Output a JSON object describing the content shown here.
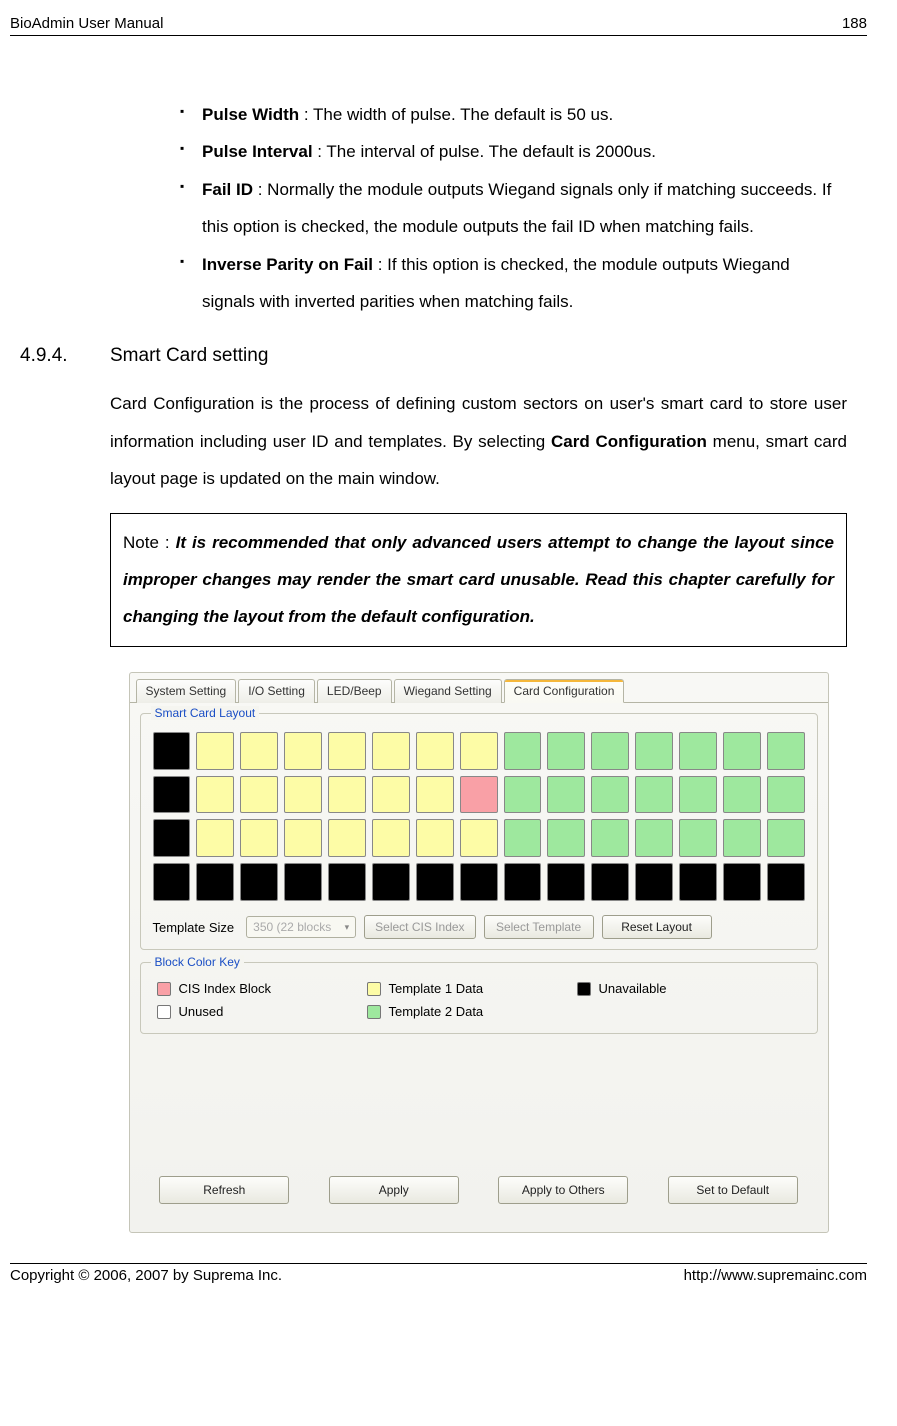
{
  "header": {
    "title": "BioAdmin User Manual",
    "page_num": "188"
  },
  "bullets": [
    {
      "label": "Pulse Width",
      "text": " : The width of pulse. The default is 50 us."
    },
    {
      "label": "Pulse Interval",
      "text": " : The interval of pulse. The default is 2000us."
    },
    {
      "label": "Fail ID",
      "text": " : Normally the module outputs Wiegand signals only if matching succeeds. If this option is checked, the module outputs the fail ID when matching fails."
    },
    {
      "label": "Inverse Parity on Fail",
      "text": " : If this option is checked, the module outputs Wiegand signals with inverted parities when matching fails."
    }
  ],
  "section": {
    "num": "4.9.4.",
    "title": "Smart Card setting"
  },
  "para": {
    "pre": "Card Configuration is the process of defining custom sectors on user's smart card to store user information including user ID and templates. By selecting ",
    "bold": "Card Configuration",
    "post": " menu, smart card layout page is updated on the main window."
  },
  "note": {
    "prefix": "Note : ",
    "body": "It is recommended that only advanced users attempt to change the layout since improper changes may render the smart card unusable. Read this chapter carefully for changing the layout from the default configuration."
  },
  "app": {
    "tabs": [
      "System Setting",
      "I/O Setting",
      "LED/Beep",
      "Wiegand Setting",
      "Card Configuration"
    ],
    "active_tab": 4,
    "fieldset1_legend": "Smart Card Layout",
    "grid": [
      [
        "black",
        "yellow",
        "yellow",
        "yellow",
        "yellow",
        "yellow",
        "yellow",
        "yellow",
        "green",
        "green",
        "green",
        "green",
        "green",
        "green",
        "green"
      ],
      [
        "black",
        "yellow",
        "yellow",
        "yellow",
        "yellow",
        "yellow",
        "yellow",
        "pink",
        "green",
        "green",
        "green",
        "green",
        "green",
        "green",
        "green"
      ],
      [
        "black",
        "yellow",
        "yellow",
        "yellow",
        "yellow",
        "yellow",
        "yellow",
        "yellow",
        "green",
        "green",
        "green",
        "green",
        "green",
        "green",
        "green"
      ],
      [
        "black",
        "black",
        "black",
        "black",
        "black",
        "black",
        "black",
        "black",
        "black",
        "black",
        "black",
        "black",
        "black",
        "black",
        "black"
      ]
    ],
    "template_size_label": "Template Size",
    "template_size_value": "350 (22 blocks",
    "btn_select_cis": "Select CIS Index",
    "btn_select_template": "Select Template",
    "btn_reset": "Reset Layout",
    "fieldset2_legend": "Block Color Key",
    "legend_items": [
      {
        "color": "pink",
        "label": "CIS Index Block"
      },
      {
        "color": "yellow",
        "label": "Template 1 Data"
      },
      {
        "color": "black",
        "label": "Unavailable"
      },
      {
        "color": "white",
        "label": "Unused"
      },
      {
        "color": "green",
        "label": "Template 2 Data"
      }
    ],
    "bottom": [
      "Refresh",
      "Apply",
      "Apply to Others",
      "Set to Default"
    ]
  },
  "footer": {
    "left": "Copyright © 2006, 2007 by Suprema Inc.",
    "right": "http://www.supremainc.com"
  }
}
